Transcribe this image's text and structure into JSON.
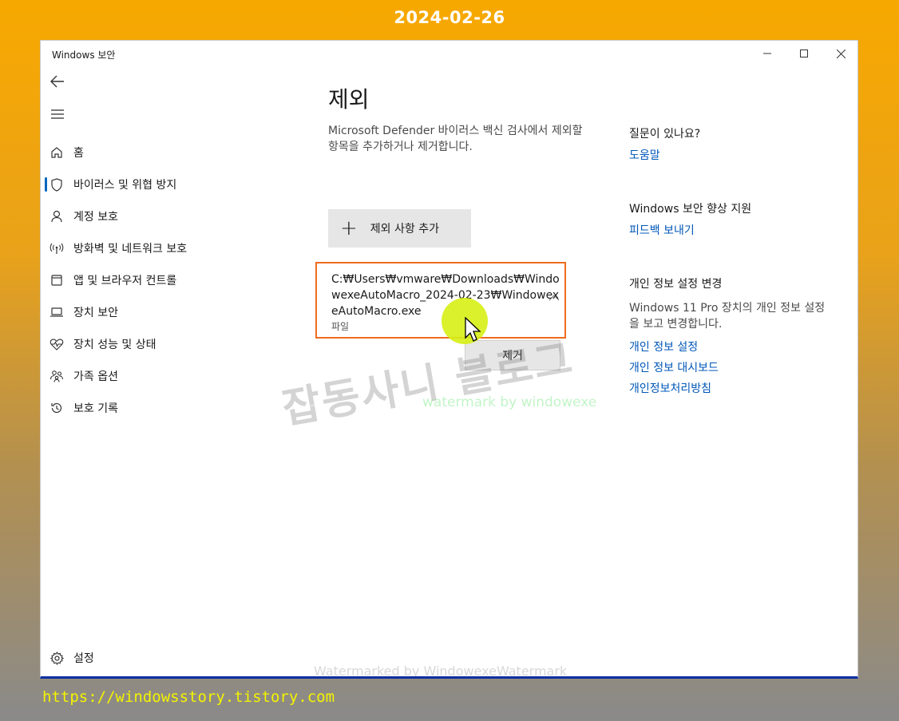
{
  "overlay": {
    "date": "2024-02-26",
    "url": "https://windowsstory.tistory.com"
  },
  "window": {
    "title": "Windows 보안",
    "controls": {
      "minimize_icon": "minimize-icon",
      "maximize_icon": "maximize-icon",
      "close_icon": "close-icon"
    }
  },
  "nav": {
    "items": [
      {
        "label": "홈",
        "icon": "home-icon"
      },
      {
        "label": "바이러스 및 위협 방지",
        "icon": "shield-icon",
        "active": true
      },
      {
        "label": "계정 보호",
        "icon": "person-icon"
      },
      {
        "label": "방화벽 및 네트워크 보호",
        "icon": "wifi-signal-icon"
      },
      {
        "label": "앱 및 브라우저 컨트롤",
        "icon": "app-window-icon"
      },
      {
        "label": "장치 보안",
        "icon": "laptop-icon"
      },
      {
        "label": "장치 성능 및 상태",
        "icon": "heart-pulse-icon"
      },
      {
        "label": "가족 옵션",
        "icon": "family-icon"
      },
      {
        "label": "보호 기록",
        "icon": "history-icon"
      }
    ],
    "settings_label": "설정"
  },
  "main": {
    "title": "제외",
    "description": "Microsoft Defender 바이러스 백신 검사에서 제외할 항목을 추가하거나 제거합니다.",
    "add_button_label": "제외 사항 추가",
    "exclusion": {
      "path": "C:₩Users₩vmware₩Downloads₩WindowexeAutoMacro_2024-02-23₩WindowexeAutoMacro.exe",
      "type": "파일"
    },
    "remove_button_label": "제거"
  },
  "sidebar_right": {
    "help_heading": "질문이 있나요?",
    "help_link": "도움말",
    "improve_heading": "Windows 보안 향상 지원",
    "feedback_link": "피드백 보내기",
    "privacy_heading": "개인 정보 설정 변경",
    "privacy_text": "Windows 11 Pro 장치의 개인 정보 설정을 보고 변경합니다.",
    "privacy_links": [
      "개인 정보 설정",
      "개인 정보 대시보드",
      "개인정보처리방침"
    ]
  },
  "watermarks": {
    "big": "잡동사니 블로그",
    "green": "watermark by windowexe",
    "bottom": "Watermarked by WindowexeWatermark"
  },
  "colors": {
    "accent": "#0067c0",
    "link": "#0057b8",
    "highlight_border": "#ef6b1f",
    "cursor_highlight": "#d6f014"
  }
}
